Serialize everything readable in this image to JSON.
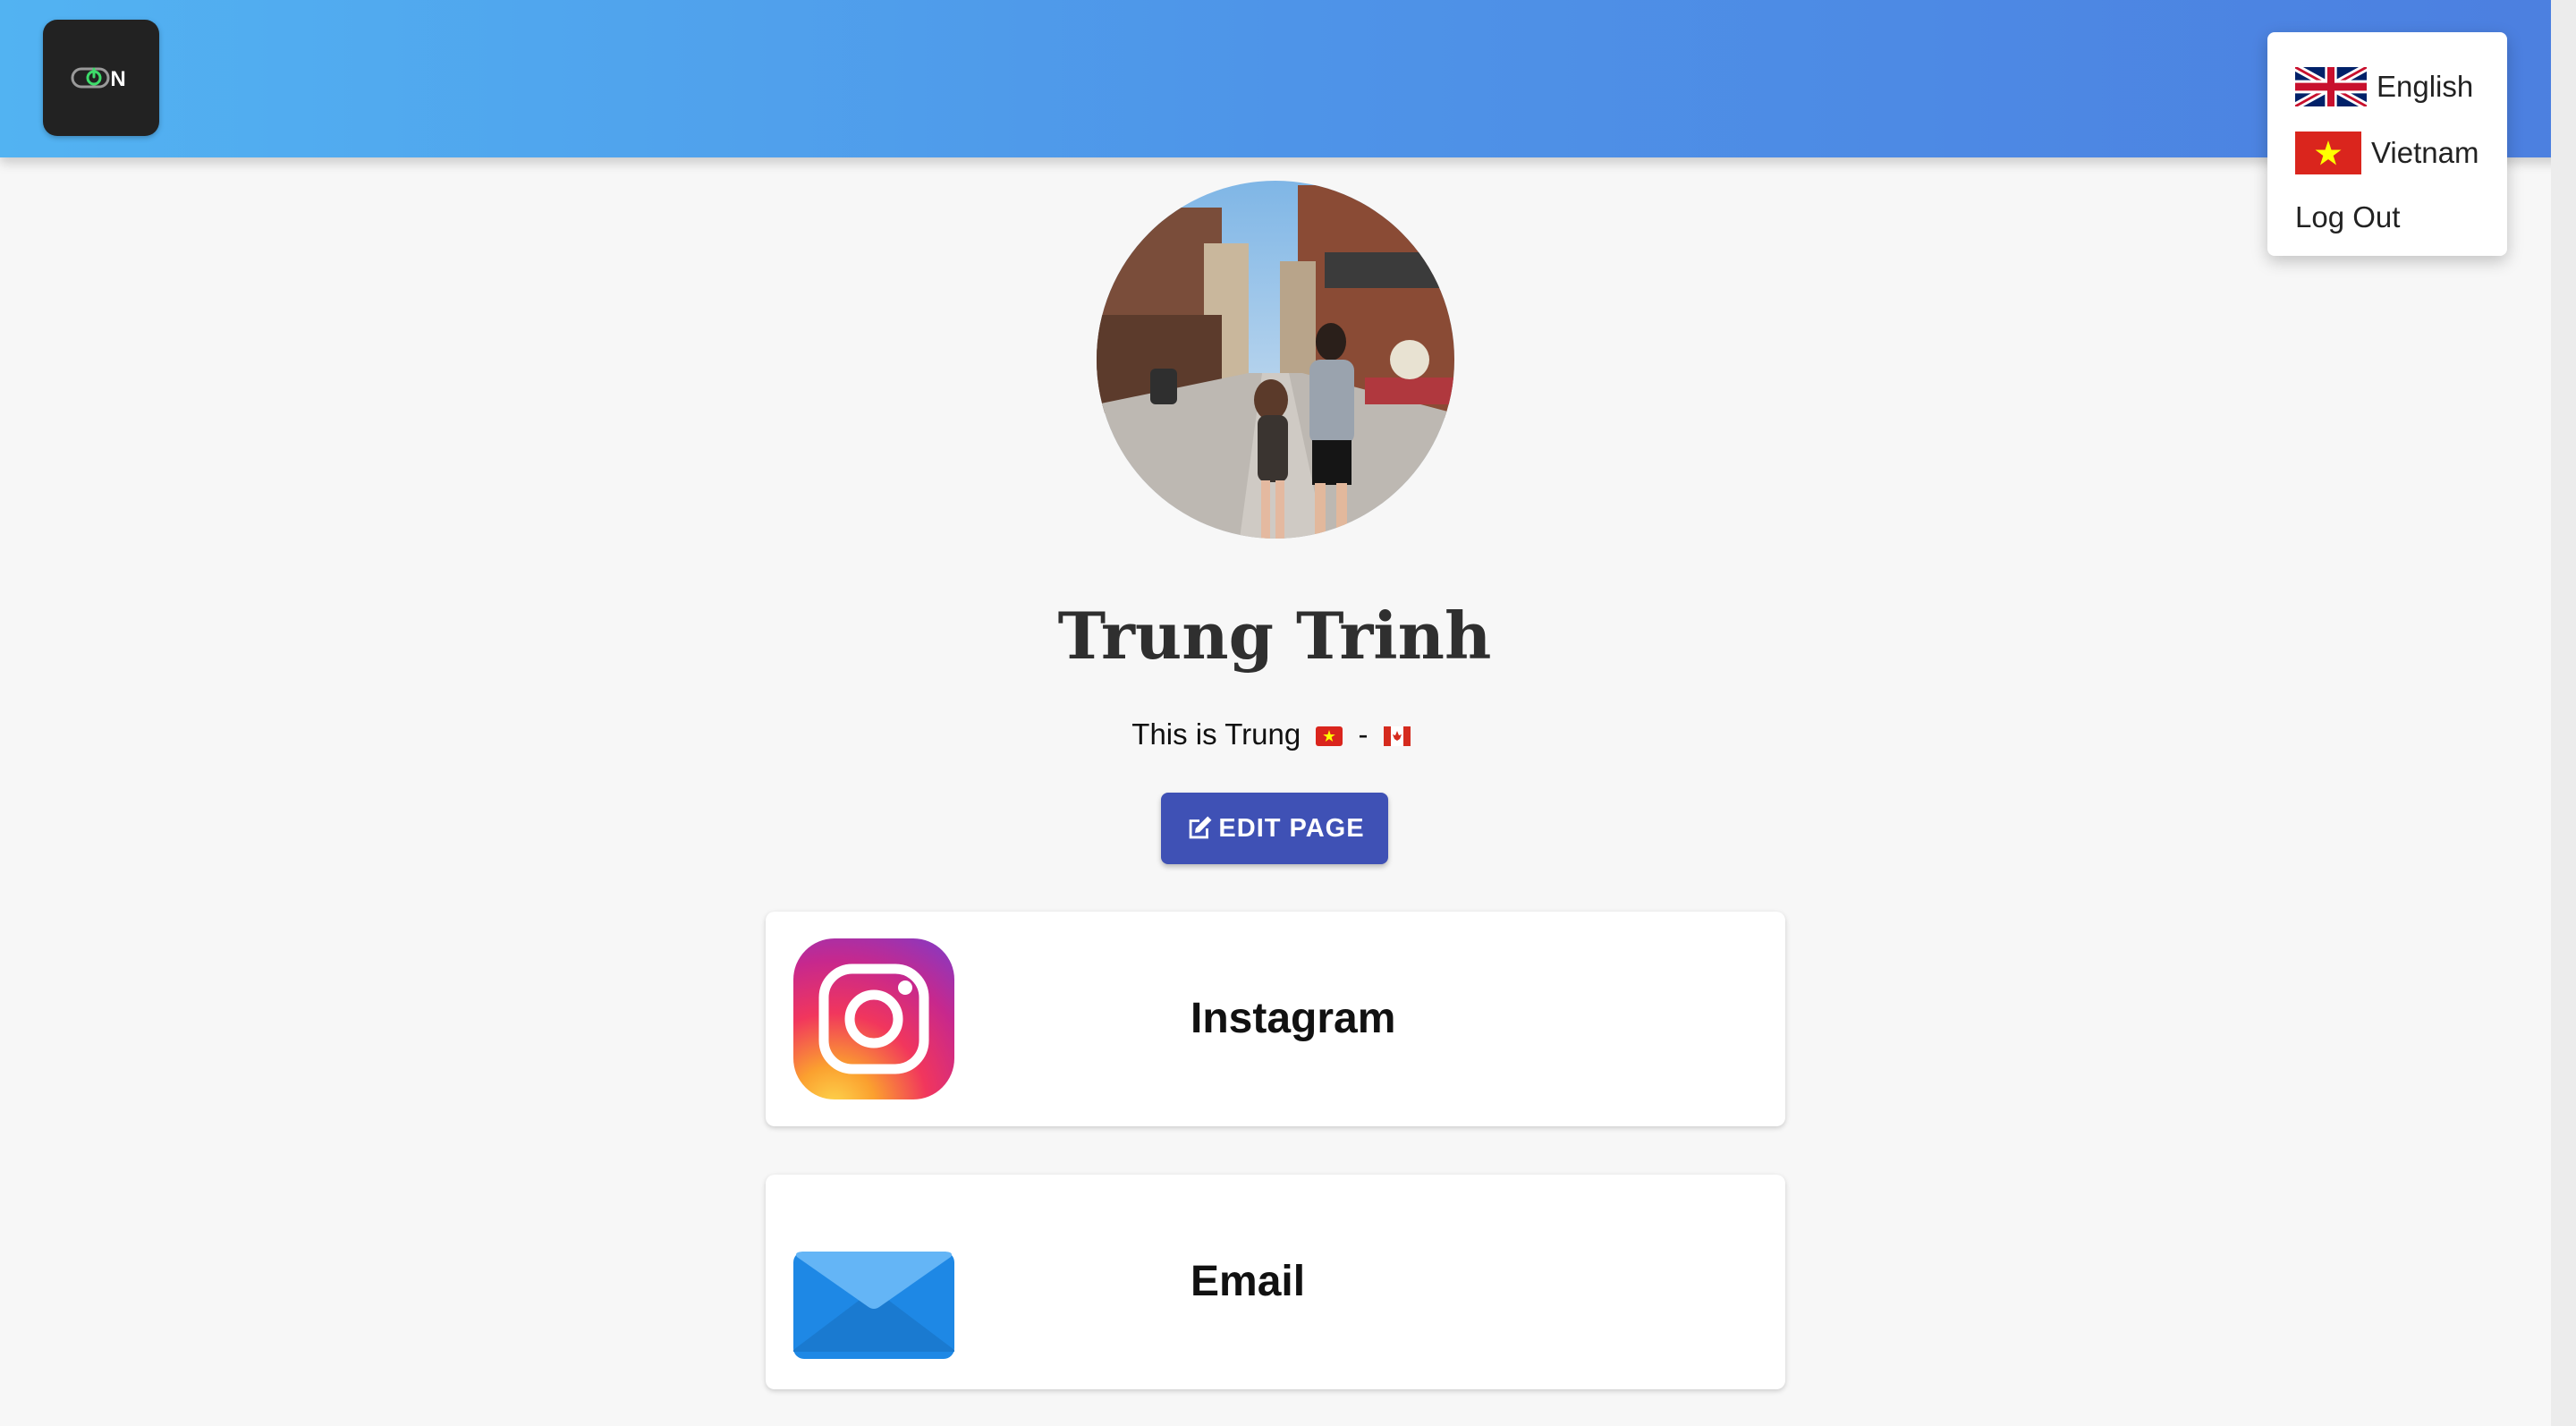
{
  "header": {
    "logo_text": "ON"
  },
  "language_menu": {
    "items": [
      {
        "label": "English",
        "flag": "uk-flag-icon"
      },
      {
        "label": "Vietnam",
        "flag": "vietnam-flag-icon"
      },
      {
        "label": "Log Out"
      }
    ]
  },
  "profile": {
    "name": "Trung Trinh",
    "bio_prefix": "This is Trung",
    "bio_separator": "-",
    "edit_button_label": "EDIT PAGE"
  },
  "links": [
    {
      "label": "Instagram",
      "icon": "instagram-icon"
    },
    {
      "label": "Email",
      "icon": "email-icon"
    }
  ],
  "colors": {
    "header_gradient_start": "#52b3f2",
    "header_gradient_end": "#4c7fe0",
    "edit_button": "#3f51b5",
    "background": "#f7f7f7"
  }
}
